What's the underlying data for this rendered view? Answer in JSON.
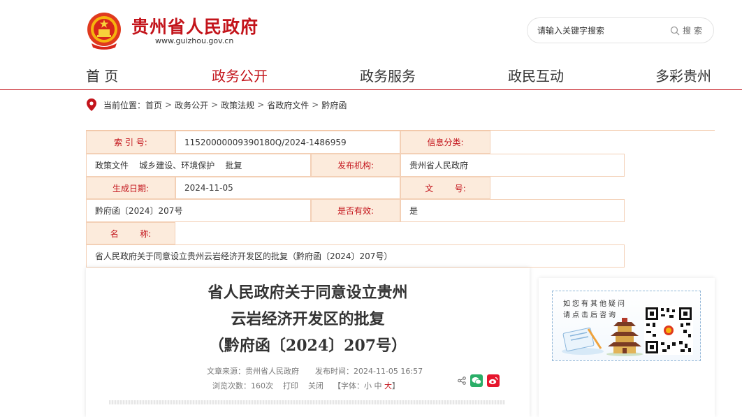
{
  "header": {
    "site_title": "贵州省人民政府",
    "site_url": "www.guizhou.gov.cn",
    "search_placeholder": "请输入关键字搜索",
    "search_button": "搜索",
    "search_icon": "search-icon",
    "emblem_icon": "national-emblem-icon"
  },
  "nav": [
    "首 页",
    "政务公开",
    "政务服务",
    "政民互动",
    "多彩贵州"
  ],
  "nav_active_index": 1,
  "breadcrumb": {
    "icon": "location-pin-icon",
    "prefix": "当前位置：",
    "items": [
      "首页",
      "政务公开",
      "政策法规",
      "省政府文件",
      "黔府函"
    ],
    "separator": ">"
  },
  "info": {
    "index_label": "索 引 号:",
    "index_value": "11520000009390180Q/2024-1486959",
    "category_label": "信息分类:",
    "category_value": "政策文件    城乡建设、环境保护    批复",
    "issuer_label": "发布机构:",
    "issuer_value": "贵州省人民政府",
    "date_label": "生成日期:",
    "date_value": "2024-11-05",
    "docno_label": "文        号:",
    "docno_value": "黔府函〔2024〕207号",
    "valid_label": "是否有效:",
    "valid_value": "是",
    "name_label": "名        称:",
    "name_value": "省人民政府关于同意设立贵州云岩经济开发区的批复（黔府函〔2024〕207号）"
  },
  "article": {
    "title_lines": [
      "省人民政府关于同意设立贵州",
      "云岩经济开发区的批复",
      "（黔府函〔2024〕207号）"
    ],
    "source": "文章来源：贵州省人民政府",
    "publish_time": "发布时间：2024-11-05 16:57",
    "views": "浏览次数：160次",
    "print": "打印",
    "close": "关闭",
    "font_prefix": "【字体：",
    "font_small": "小",
    "font_medium": "中",
    "font_large": "大",
    "font_suffix": "】",
    "share_icons": [
      "share-icon",
      "wechat-icon",
      "weibo-icon"
    ]
  },
  "side": {
    "qr_line1": "如您有其他疑问",
    "qr_line2": "请点击后咨询"
  },
  "colors": {
    "brand_red": "#c3141b",
    "table_key_bg": "#fcebdc",
    "table_border": "#f3d0b6",
    "wechat_green": "#2aae67",
    "weibo_red": "#e6162d"
  }
}
